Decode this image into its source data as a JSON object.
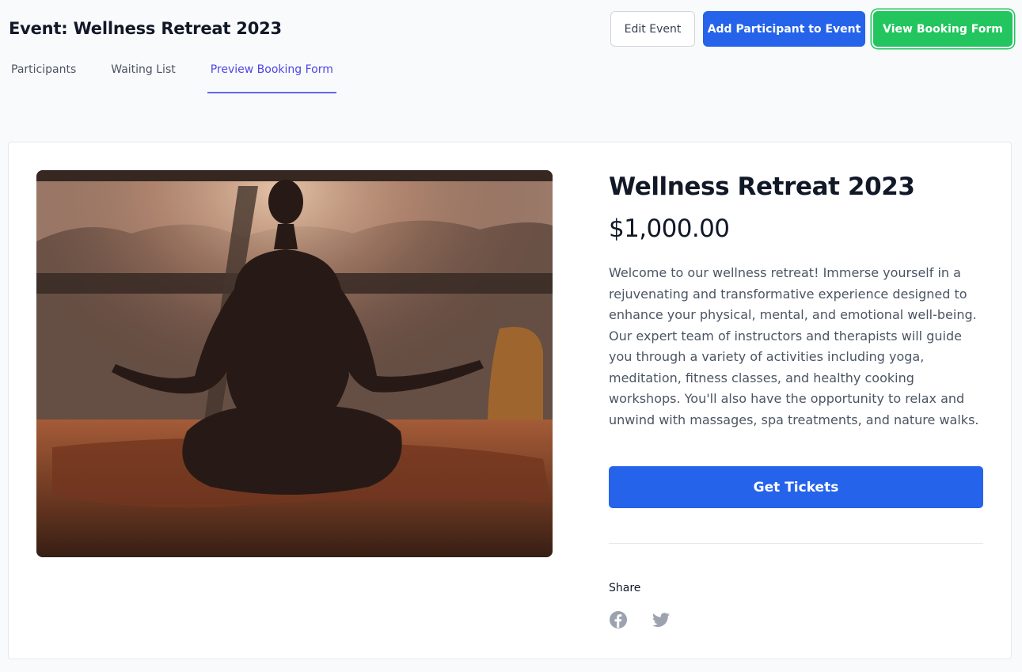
{
  "header": {
    "title": "Event: Wellness Retreat 2023",
    "buttons": {
      "edit": "Edit Event",
      "add": "Add Participant to Event",
      "view": "View Booking Form"
    }
  },
  "tabs": [
    {
      "label": "Participants"
    },
    {
      "label": "Waiting List"
    },
    {
      "label": "Preview Booking Form",
      "active": true
    }
  ],
  "event": {
    "name": "Wellness Retreat 2023",
    "price": "$1,000.00",
    "description": "Welcome to our wellness retreat! Immerse yourself in a rejuvenating and transformative experience designed to enhance your physical, mental, and emotional well-being. Our expert team of instructors and therapists will guide you through a variety of activities including yoga, meditation, fitness classes, and healthy cooking workshops. You'll also have the opportunity to relax and unwind with massages, spa treatments, and nature walks.",
    "cta": "Get Tickets",
    "share_label": "Share",
    "share_icons": [
      "facebook-icon",
      "twitter-icon"
    ]
  },
  "colors": {
    "primary": "#2563eb",
    "success": "#22c55e",
    "active_tab": "#4f46e5"
  }
}
